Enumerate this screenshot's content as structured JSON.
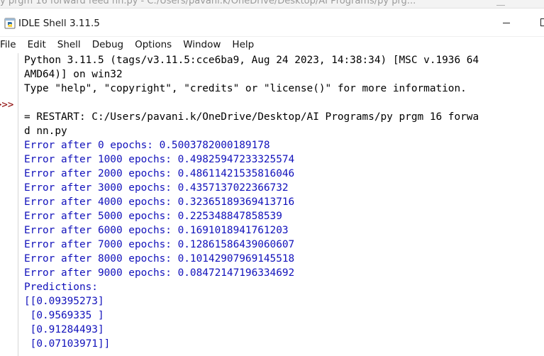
{
  "background_window": {
    "title": "y prgm 16 forward feed nn.py - C:/Users/pavani.k/OneDrive/Desktop/AI Programs/py prg..."
  },
  "window": {
    "title": "IDLE Shell 3.11.5",
    "icon": "idle-python-icon"
  },
  "menu": {
    "items": [
      "File",
      "Edit",
      "Shell",
      "Debug",
      "Options",
      "Window",
      "Help"
    ]
  },
  "shell": {
    "prompt": ">>>",
    "banner": [
      "Python 3.11.5 (tags/v3.11.5:cce6ba9, Aug 24 2023, 14:38:34) [MSC v.1936 64",
      "AMD64)] on win32",
      "Type \"help\", \"copyright\", \"credits\" or \"license()\" for more information."
    ],
    "restart": [
      "= RESTART: C:/Users/pavani.k/OneDrive/Desktop/AI Programs/py prgm 16 forwa",
      "d nn.py"
    ],
    "output": [
      "Error after 0 epochs: 0.5003782000189178",
      "Error after 1000 epochs: 0.49825947233325574",
      "Error after 2000 epochs: 0.48611421535816046",
      "Error after 3000 epochs: 0.4357137022366732",
      "Error after 4000 epochs: 0.32365189369413716",
      "Error after 5000 epochs: 0.225348847858539",
      "Error after 6000 epochs: 0.1691018941761203",
      "Error after 7000 epochs: 0.12861586439060607",
      "Error after 8000 epochs: 0.10142907969145518",
      "Error after 9000 epochs: 0.08472147196334692",
      "Predictions:",
      "[[0.09395273]",
      " [0.9569335 ]",
      " [0.91284493]",
      " [0.07103971]]"
    ],
    "colors": {
      "output_text": "#1111bb",
      "prompt": "#8a0000",
      "default_text": "#000000"
    }
  }
}
